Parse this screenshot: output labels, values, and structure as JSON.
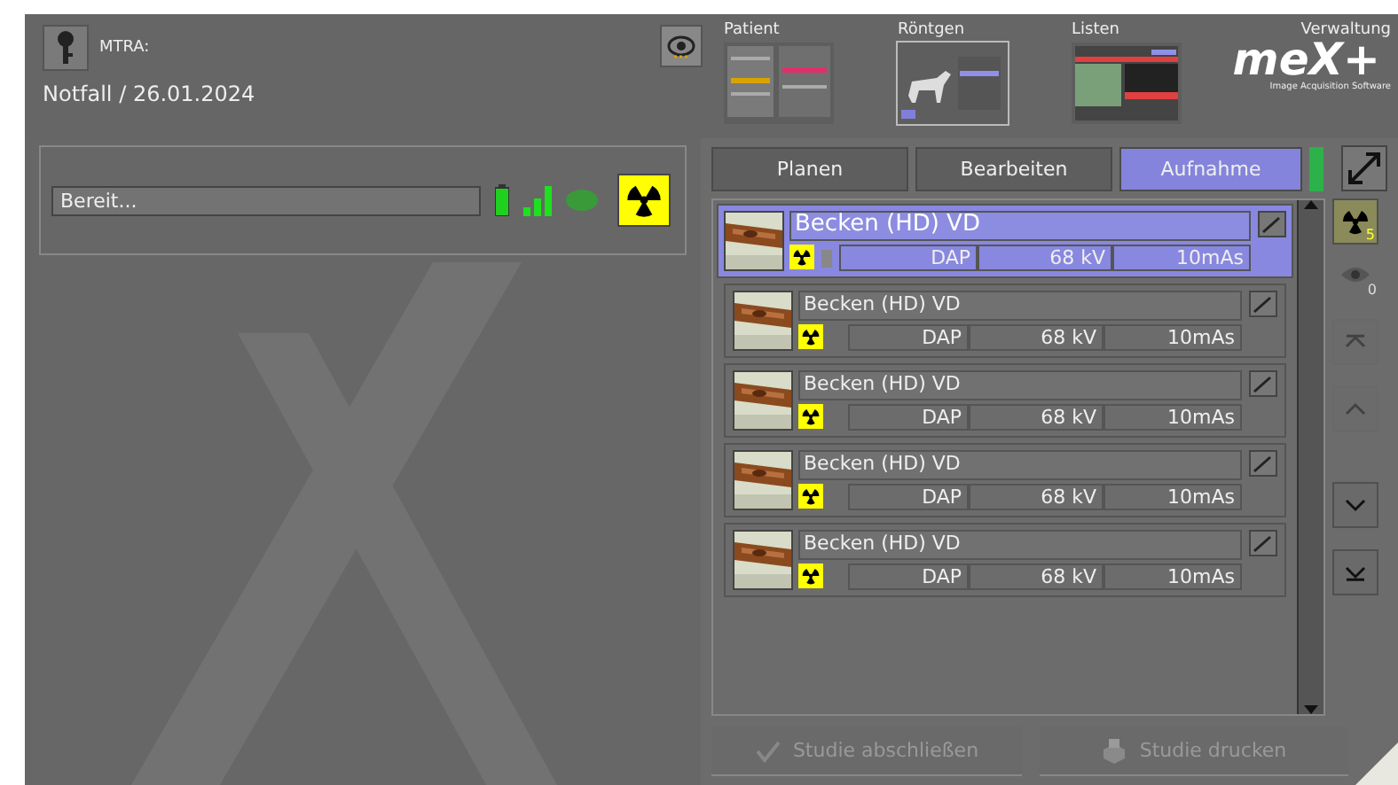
{
  "header": {
    "role_label": "MTRA:",
    "context": "Notfall / 26.01.2024"
  },
  "nav": [
    {
      "label": "Patient",
      "kind": "form",
      "selected": false
    },
    {
      "label": "Röntgen",
      "kind": "xray",
      "selected": true
    },
    {
      "label": "Listen",
      "kind": "table",
      "selected": false
    }
  ],
  "logo": {
    "label": "Verwaltung",
    "wordmark": "meX+",
    "tagline": "Image Acquisition Software"
  },
  "status": {
    "message": "Bereit..."
  },
  "tabs": [
    {
      "label": "Planen",
      "selected": false
    },
    {
      "label": "Bearbeiten",
      "selected": false
    },
    {
      "label": "Aufnahme",
      "selected": true
    }
  ],
  "exposures": [
    {
      "name": "Becken (HD) VD",
      "dose": "DAP",
      "voltage": "68 kV",
      "charge": "10mAs",
      "selected": true
    },
    {
      "name": "Becken (HD) VD",
      "dose": "DAP",
      "voltage": "68 kV",
      "charge": "10mAs",
      "selected": false
    },
    {
      "name": "Becken (HD) VD",
      "dose": "DAP",
      "voltage": "68 kV",
      "charge": "10mAs",
      "selected": false
    },
    {
      "name": "Becken (HD) VD",
      "dose": "DAP",
      "voltage": "68 kV",
      "charge": "10mAs",
      "selected": false
    },
    {
      "name": "Becken (HD) VD",
      "dose": "DAP",
      "voltage": "68 kV",
      "charge": "10mAs",
      "selected": false
    }
  ],
  "counts": {
    "exposures": "5",
    "viewed": "0"
  },
  "navigation": [
    {
      "kind": "top",
      "disabled": true
    },
    {
      "kind": "up",
      "disabled": true
    },
    {
      "kind": "down",
      "disabled": false
    },
    {
      "kind": "bottom",
      "disabled": false
    }
  ],
  "actions": [
    {
      "label": "Studie abschließen",
      "kind": "finish",
      "disabled": true
    },
    {
      "label": "Studie drucken",
      "kind": "print",
      "disabled": true
    }
  ]
}
